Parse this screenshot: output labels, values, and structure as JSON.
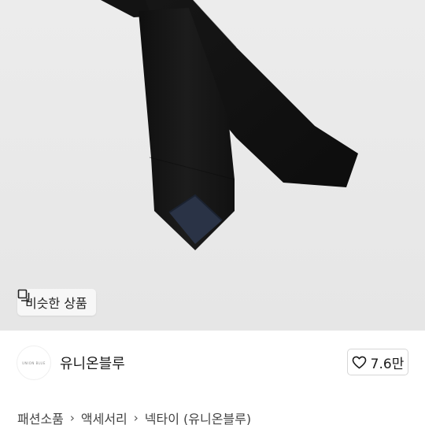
{
  "similar_button": {
    "icon": "similar-items-icon",
    "label": "비슷한 상품"
  },
  "seller": {
    "avatar_text": "UNION BLUE",
    "name": "유니온블루"
  },
  "like": {
    "icon": "heart-outline-icon",
    "count": "7.6만"
  },
  "breadcrumb": {
    "items": [
      "패션소품",
      "액세서리",
      "넥타이 (유니온블루)"
    ],
    "separator": "›"
  },
  "colors": {
    "image_background": "#e9e9e9",
    "tie_black": "#151515",
    "tie_lining_navy": "#2a3346"
  }
}
